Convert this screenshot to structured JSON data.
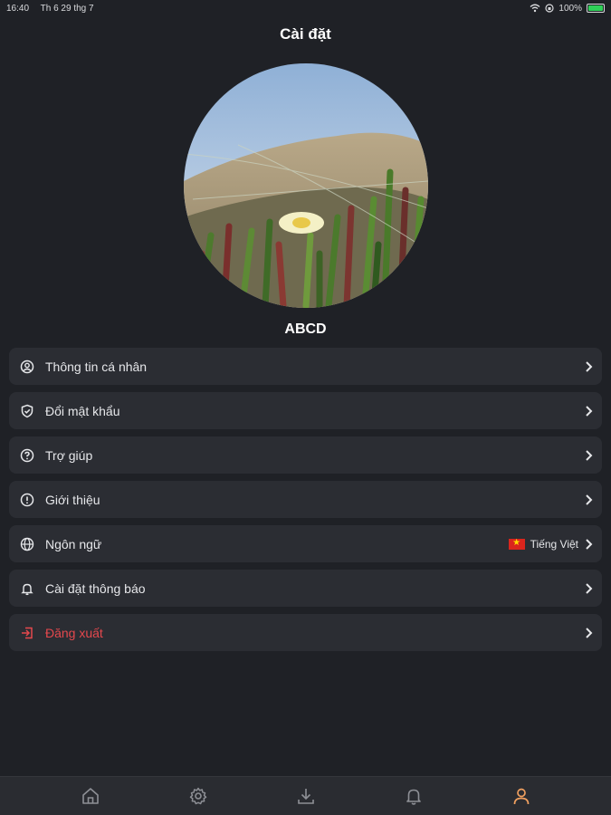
{
  "status_bar": {
    "time": "16:40",
    "date": "Th 6 29 thg 7",
    "battery": "100%"
  },
  "header": {
    "title": "Cài đặt"
  },
  "profile": {
    "name": "ABCD"
  },
  "menu": [
    {
      "label": "Thông tin cá nhân",
      "icon": "user-circle-icon"
    },
    {
      "label": "Đổi mật khẩu",
      "icon": "shield-icon"
    },
    {
      "label": "Trợ giúp",
      "icon": "help-circle-icon"
    },
    {
      "label": "Giới thiệu",
      "icon": "info-circle-icon"
    },
    {
      "label": "Ngôn ngữ",
      "icon": "globe-icon",
      "value": "Tiếng Việt"
    },
    {
      "label": "Cài đặt thông báo",
      "icon": "bell-icon"
    },
    {
      "label": "Đăng xuất",
      "icon": "logout-icon"
    }
  ],
  "tabs": [
    "home",
    "settings",
    "download",
    "notifications",
    "profile"
  ],
  "colors": {
    "background": "#1f2126",
    "card": "#2b2d33",
    "danger": "#e5484d",
    "active_tab": "#f0a060"
  }
}
